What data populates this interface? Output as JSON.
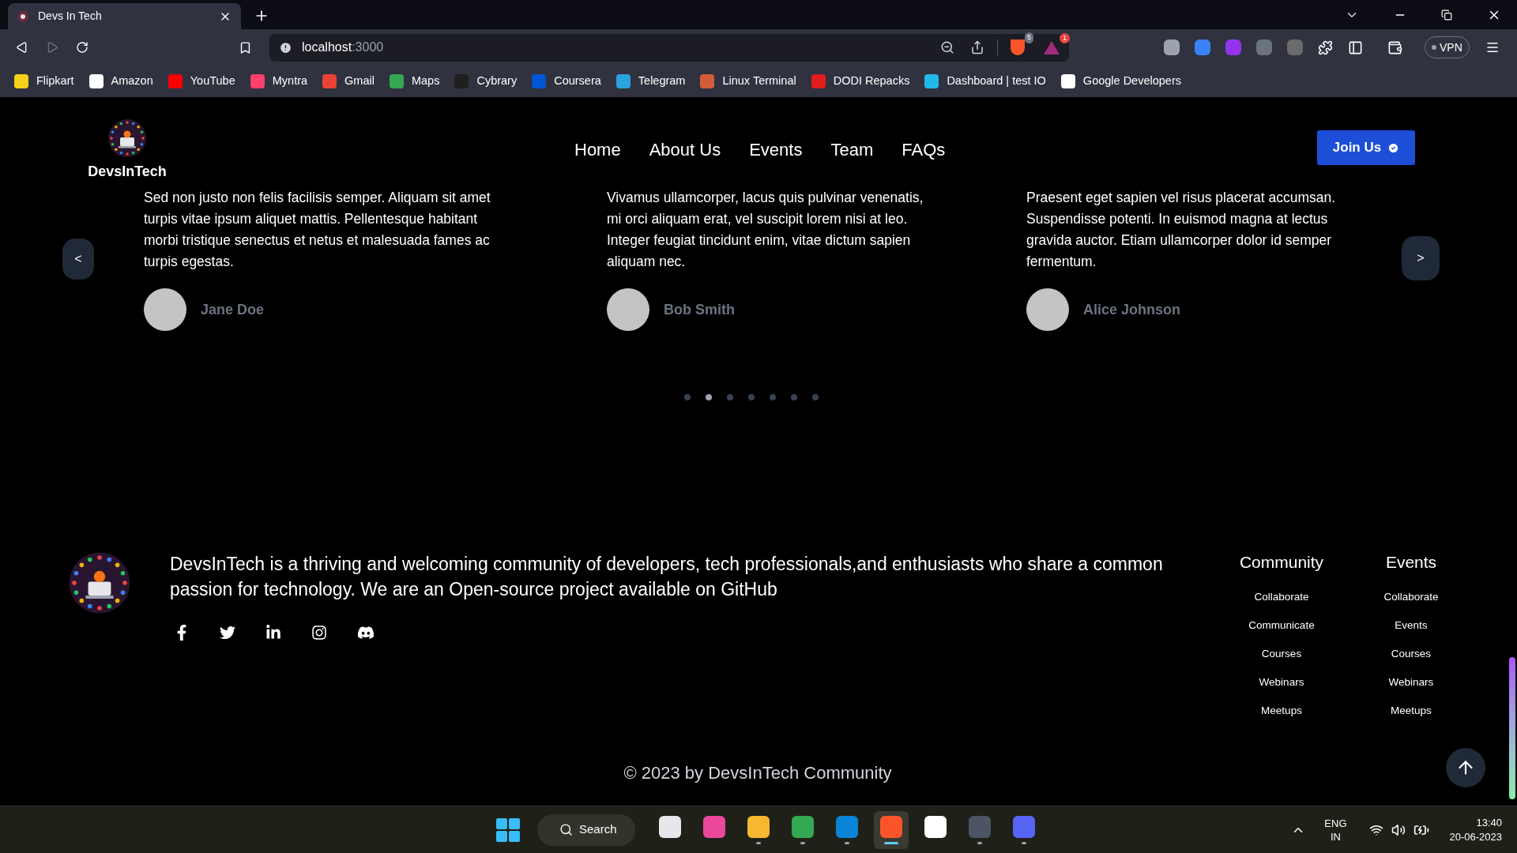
{
  "browser": {
    "tab": {
      "title": "Devs In Tech",
      "selected": true
    },
    "address": {
      "host": "localhost",
      "port": ":3000"
    },
    "shields_count": "5",
    "rewards_count": "1",
    "vpn": "VPN",
    "extensions": [
      {
        "color": "#9ca3af"
      },
      {
        "color": "#3b82f6"
      },
      {
        "color": "#9333ea"
      },
      {
        "color": "#6b7280"
      },
      {
        "color": "#6b6b6b"
      }
    ],
    "bookmarks": [
      {
        "label": "Flipkart",
        "color": "#f7d117"
      },
      {
        "label": "Amazon",
        "color": "#ffffff"
      },
      {
        "label": "YouTube",
        "color": "#ff0000"
      },
      {
        "label": "Myntra",
        "color": "#ff3f6c"
      },
      {
        "label": "Gmail",
        "color": "#ea4335"
      },
      {
        "label": "Maps",
        "color": "#34a853"
      },
      {
        "label": "Cybrary",
        "color": "#1f1f1f"
      },
      {
        "label": "Coursera",
        "color": "#0056d2"
      },
      {
        "label": "Telegram",
        "color": "#2aa3df"
      },
      {
        "label": "Linux Terminal",
        "color": "#d35d3a"
      },
      {
        "label": "DODI Repacks",
        "color": "#e11d1d"
      },
      {
        "label": "Dashboard | test IO",
        "color": "#22b8e8"
      },
      {
        "label": "Google Developers",
        "color": "#ffffff"
      }
    ]
  },
  "site": {
    "brand": "DevsInTech",
    "nav": [
      {
        "label": "Home"
      },
      {
        "label": "About Us"
      },
      {
        "label": "Events"
      },
      {
        "label": "Team"
      },
      {
        "label": "FAQs"
      }
    ],
    "join_button": "Join Us",
    "prev": "<",
    "next": ">",
    "testimonials": [
      {
        "lines": [
          "Sed non justo non felis facilisis semper. Aliquam sit amet",
          "turpis vitae ipsum aliquet mattis. Pellentesque habitant",
          "morbi tristique senectus et netus et malesuada fames ac",
          "turpis egestas."
        ],
        "name": "Jane Doe"
      },
      {
        "lines": [
          "Vivamus ullamcorper, lacus quis pulvinar venenatis,",
          "mi orci aliquam erat, vel suscipit lorem nisi at leo.",
          "Integer feugiat tincidunt enim, vitae dictum sapien",
          "aliquam nec."
        ],
        "name": "Bob Smith"
      },
      {
        "lines": [
          "Praesent eget sapien vel risus placerat accumsan.",
          "Suspendisse potenti. In euismod magna at lectus",
          "gravida auctor. Etiam ullamcorper dolor id semper",
          "fermentum."
        ],
        "name": "Alice Johnson"
      }
    ],
    "dots": [
      {
        "selected": false
      },
      {
        "selected": true
      },
      {
        "selected": false
      },
      {
        "selected": false
      },
      {
        "selected": false
      },
      {
        "selected": false
      },
      {
        "selected": false
      }
    ]
  },
  "footer": {
    "about_lines": [
      "DevsInTech is a thriving and welcoming community of developers, tech professionals,and enthusiasts who share a common",
      "passion for technology. We are an Open-source project available on GitHub"
    ],
    "socials": [
      {
        "kind": "facebook"
      },
      {
        "kind": "twitter"
      },
      {
        "kind": "linkedin"
      },
      {
        "kind": "instagram"
      },
      {
        "kind": "discord"
      }
    ],
    "columns": [
      {
        "title": "Community",
        "links": [
          "Collaborate",
          "Communicate",
          "Courses",
          "Webinars",
          "Meetups"
        ]
      },
      {
        "title": "Events",
        "links": [
          "Collaborate",
          "Events",
          "Courses",
          "Webinars",
          "Meetups"
        ]
      }
    ],
    "copyright": "© 2023 by DevsInTech Community"
  },
  "taskbar": {
    "search": "Search",
    "apps": [
      {
        "color": "#e5e7eb",
        "running": false,
        "selected": false
      },
      {
        "color": "#ec4899",
        "running": false,
        "selected": false
      },
      {
        "color": "#f5b82e",
        "running": true,
        "selected": false
      },
      {
        "color": "#34a853",
        "running": true,
        "selected": false
      },
      {
        "color": "#0a84d6",
        "running": true,
        "selected": false
      },
      {
        "color": "#fb542b",
        "running": true,
        "selected": true
      },
      {
        "color": "#ffffff",
        "running": false,
        "selected": false
      },
      {
        "color": "#4b5563",
        "running": true,
        "selected": false
      },
      {
        "color": "#5865f2",
        "running": true,
        "selected": false
      }
    ],
    "lang": "ENG",
    "region": "IN",
    "time": "13:40",
    "date": "20-06-2023"
  }
}
